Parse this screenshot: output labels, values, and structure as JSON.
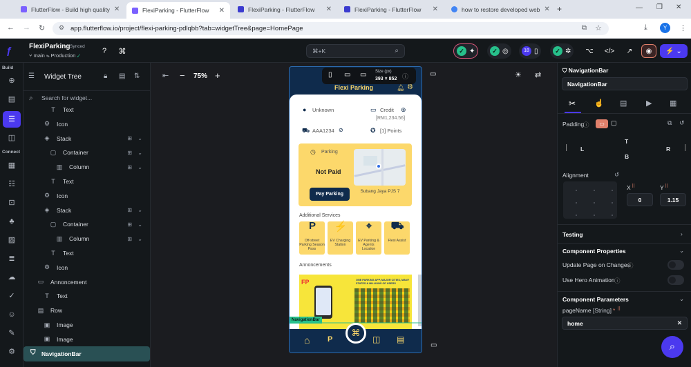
{
  "browser": {
    "tabs": [
      {
        "title": "FlutterFlow - Build high quality",
        "active": false,
        "color": "#7b61ff"
      },
      {
        "title": "FlexiParking - FlutterFlow",
        "active": true,
        "color": "#7b61ff"
      },
      {
        "title": "FlexiParking - FlutterFlow",
        "active": false,
        "color": "#3b3bcf"
      },
      {
        "title": "FlexiParking - FlutterFlow",
        "active": false,
        "color": "#3b3bcf"
      },
      {
        "title": "how to restore developed web",
        "active": false,
        "color": "#4285f4"
      }
    ],
    "url": "app.flutterflow.io/project/flexi-parking-pdlqbb?tab=widgetTree&page=HomePage",
    "profile_initial": "Y"
  },
  "topbar": {
    "project_name": "FlexiParking",
    "sync_status": "Synced",
    "branch": "main",
    "env": "Production",
    "search_placeholder": "⌘+K",
    "badge_count": "18"
  },
  "rail": {
    "build_label": "Build",
    "connect_label": "Connect"
  },
  "tree": {
    "title": "Widget Tree",
    "search_placeholder": "Search for widget...",
    "rows": [
      {
        "label": "Text",
        "depth": 3,
        "icon": "T"
      },
      {
        "label": "Icon",
        "depth": 2,
        "icon": "⚙"
      },
      {
        "label": "Stack",
        "depth": 2,
        "icon": "◈"
      },
      {
        "label": "Container",
        "depth": 3,
        "icon": "▢"
      },
      {
        "label": "Column",
        "depth": 4,
        "icon": "▥"
      },
      {
        "label": "Text",
        "depth": 3,
        "icon": "T"
      },
      {
        "label": "Icon",
        "depth": 2,
        "icon": "⚙"
      },
      {
        "label": "Stack",
        "depth": 2,
        "icon": "◈"
      },
      {
        "label": "Container",
        "depth": 3,
        "icon": "▢"
      },
      {
        "label": "Column",
        "depth": 4,
        "icon": "▥"
      },
      {
        "label": "Text",
        "depth": 3,
        "icon": "T"
      },
      {
        "label": "Icon",
        "depth": 2,
        "icon": "⚙"
      },
      {
        "label": "Annoncement",
        "depth": 1,
        "icon": "▭"
      },
      {
        "label": "Text",
        "depth": 2,
        "icon": "T"
      },
      {
        "label": "Row",
        "depth": 1,
        "icon": "▤"
      },
      {
        "label": "Image",
        "depth": 2,
        "icon": "▣"
      },
      {
        "label": "Image",
        "depth": 2,
        "icon": "▣"
      }
    ],
    "selected": "NavigationBar"
  },
  "canvas": {
    "zoom": "75%",
    "size_label": "Size (px)",
    "size_value": "393 × 852"
  },
  "phone": {
    "app_title": "Flexi Parking",
    "user_name": "Unknown",
    "credit_label": "Credit",
    "credit_value": "[RM1,234.56]",
    "plate": "AAA1234",
    "points": "[1] Points",
    "parking_label": "Parking",
    "status": "Not Paid",
    "pay_button": "Pay Parking",
    "location": "Subang Jaya PJS 7",
    "additional_services": "Additional Services",
    "services": [
      {
        "label": "Off-street Parking Season Pass",
        "icon": "P"
      },
      {
        "label": "EV Charging Station",
        "icon": "⚡"
      },
      {
        "label": "EV Parking & Agents Location",
        "icon": "⌖"
      },
      {
        "label": "Flexi Assist",
        "icon": "⛟"
      }
    ],
    "announcements": "Annoncements",
    "nav_badge": "NavigationBar",
    "banner_text": "ONE PARKING APP, MAJOR CITIES, MANY STATES & MILLIONS OF USERS"
  },
  "props": {
    "widget_type": "NavigationBar",
    "widget_name": "NavigationBar",
    "padding_label": "Padding",
    "pad_t": "T",
    "pad_l": "L",
    "pad_r": "R",
    "pad_b": "B",
    "alignment_label": "Alignment",
    "x_label": "X",
    "y_label": "Y",
    "x_value": "0",
    "y_value": "1.15",
    "testing": "Testing",
    "component_properties": "Component Properties",
    "update_on_changes": "Update Page on Changes",
    "hero_animation": "Use Hero Animation",
    "component_parameters": "Component Parameters",
    "param_label": "pageName",
    "param_type": "[String]",
    "param_value": "home"
  }
}
